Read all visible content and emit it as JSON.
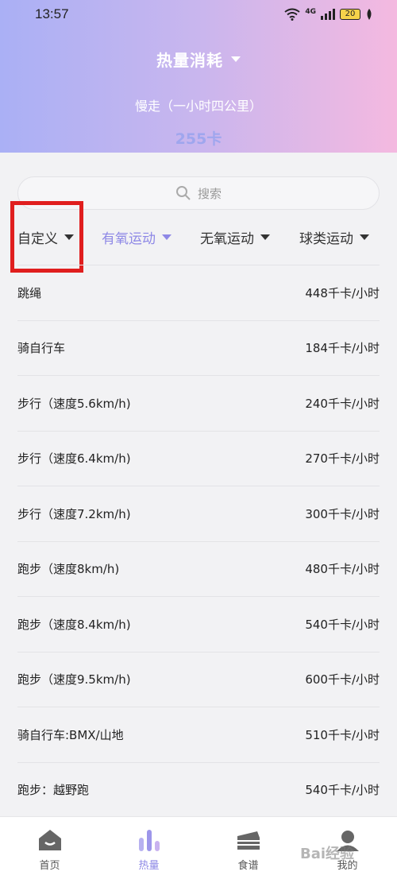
{
  "status": {
    "time": "13:57",
    "network": "4G",
    "battery": "20"
  },
  "header": {
    "title": "热量消耗",
    "subtitle": "慢走（一小时四公里）",
    "calories": "255卡"
  },
  "search": {
    "placeholder": "搜索"
  },
  "filters": [
    {
      "label": "自定义"
    },
    {
      "label": "有氧运动"
    },
    {
      "label": "无氧运动"
    },
    {
      "label": "球类运动"
    }
  ],
  "items": [
    {
      "name": "跳绳",
      "value": "448千卡/小时"
    },
    {
      "name": "骑自行车",
      "value": "184千卡/小时"
    },
    {
      "name": "步行（速度5.6km/h)",
      "value": "240千卡/小时"
    },
    {
      "name": "步行（速度6.4km/h)",
      "value": "270千卡/小时"
    },
    {
      "name": "步行（速度7.2km/h)",
      "value": "300千卡/小时"
    },
    {
      "name": "跑步（速度8km/h)",
      "value": "480千卡/小时"
    },
    {
      "name": "跑步（速度8.4km/h)",
      "value": "540千卡/小时"
    },
    {
      "name": "跑步（速度9.5km/h)",
      "value": "600千卡/小时"
    },
    {
      "name": "骑自行车:BMX/山地",
      "value": "510千卡/小时"
    },
    {
      "name": "跑步：越野跑",
      "value": "540千卡/小时"
    }
  ],
  "tabs": [
    {
      "label": "首页",
      "icon": "home-icon"
    },
    {
      "label": "热量",
      "icon": "chart-icon"
    },
    {
      "label": "食谱",
      "icon": "cake-icon"
    },
    {
      "label": "我的",
      "icon": "profile-icon"
    }
  ],
  "watermark": "Bai经验",
  "colors": {
    "accent": "#8e88e6",
    "highlight": "#e01e1e"
  }
}
